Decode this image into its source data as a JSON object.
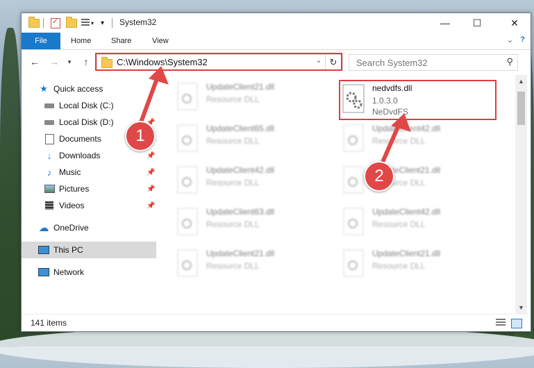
{
  "window": {
    "title": "System32",
    "minimize": "—",
    "maximize": "☐",
    "close": "✕"
  },
  "ribbon": {
    "tabs": [
      "File",
      "Home",
      "Share",
      "View"
    ],
    "help": "?"
  },
  "address": {
    "path": "C:\\Windows\\System32",
    "refresh": "↻",
    "dropdown": "⌄"
  },
  "search": {
    "placeholder": "Search System32"
  },
  "sidebar": {
    "quick_access": "Quick access",
    "items": [
      {
        "label": "Local Disk (C:)",
        "icon": "drive-icon"
      },
      {
        "label": "Local Disk (D:)",
        "icon": "drive-icon"
      },
      {
        "label": "Documents",
        "icon": "documents-icon"
      },
      {
        "label": "Downloads",
        "icon": "downloads-icon"
      },
      {
        "label": "Music",
        "icon": "music-icon"
      },
      {
        "label": "Pictures",
        "icon": "pictures-icon"
      },
      {
        "label": "Videos",
        "icon": "videos-icon"
      }
    ],
    "onedrive": "OneDrive",
    "this_pc": "This PC",
    "network": "Network"
  },
  "files": [
    {
      "name": "UpdateClient21.dll",
      "type": "Resource DLL"
    },
    {
      "name": "UpdateClient65.dll",
      "type": "Resource DLL"
    },
    {
      "name": "UpdateClient42.dll",
      "type": "Resource DLL"
    },
    {
      "name": "UpdateClient63.dll",
      "type": "Resource DLL"
    },
    {
      "name": "UpdateClient21.dll",
      "type": "Resource DLL"
    },
    {
      "name": "UpdateClient42.dll",
      "type": "Resource DLL"
    },
    {
      "name": "UpdateClient21.dll",
      "type": "Resource DLL"
    },
    {
      "name": "UpdateClient42.dll",
      "type": "Resource DLL"
    },
    {
      "name": "UpdateClient21.dll",
      "type": "Resource DLL"
    }
  ],
  "selected_file": {
    "name": "nedvdfs.dll",
    "version": "1.0.3.0",
    "description": "NeDvdFS"
  },
  "status": {
    "item_count": "141 items"
  },
  "callouts": [
    "1",
    "2"
  ],
  "colors": {
    "accent": "#1979ca",
    "highlight": "#e03c3c"
  }
}
